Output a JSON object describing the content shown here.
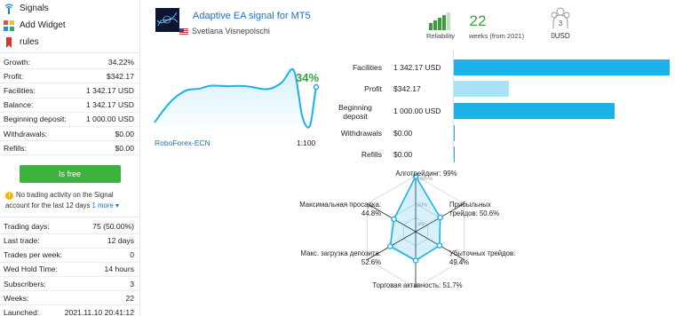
{
  "sidebar": {
    "menu": [
      {
        "label": "Signals",
        "icon": "signal-icon"
      },
      {
        "label": "Add Widget",
        "icon": "widget-icon"
      },
      {
        "label": "rules",
        "icon": "bookmark-icon"
      }
    ],
    "stats": [
      {
        "label": "Growth:",
        "value": "34.22%"
      },
      {
        "label": "Profit:",
        "value": "$342.17"
      },
      {
        "label": "Facilities:",
        "value": "1 342.17 USD"
      },
      {
        "label": "Balance:",
        "value": "1 342.17 USD"
      },
      {
        "label": "Beginning deposit:",
        "value": "1 000.00 USD"
      },
      {
        "label": "Withdrawals:",
        "value": "$0.00"
      },
      {
        "label": "Refills:",
        "value": "$0.00"
      }
    ],
    "free_button": "Is free",
    "notice": {
      "text": "No trading activity on the Signal account for the last 12 days",
      "more": "1 more"
    },
    "stats2": [
      {
        "label": "Trading days:",
        "value": "75 (50.00%)"
      },
      {
        "label": "Last trade:",
        "value": "12 days"
      },
      {
        "label": "Trades per week:",
        "value": "0"
      },
      {
        "label": "Wed Hold Time:",
        "value": "14 hours"
      },
      {
        "label": "Subscribers:",
        "value": "3"
      },
      {
        "label": "Weeks:",
        "value": "22"
      },
      {
        "label": "Launched:",
        "value": "2021.11.10 20:41:12"
      }
    ]
  },
  "header": {
    "title": "Adaptive EA signal for MT5",
    "author": "Svetlana Visnepolschi"
  },
  "metrics": {
    "reliability_label": "Reliability",
    "weeks_value": "22",
    "weeks_label": "weeks (from 2021)",
    "subscribers_count": "3",
    "subscription_price": "0USD"
  },
  "growth": {
    "value_label": "34%",
    "broker": "RoboForex-ECN",
    "leverage": "1:100"
  },
  "colors": {
    "accent_blue": "#1ab2e8",
    "light_blue": "#a7e2f7",
    "green": "#3db33d",
    "link": "#1a6fc9"
  },
  "chart_data": [
    {
      "type": "bar",
      "categories": [
        "Facilities",
        "Profit",
        "Beginning deposit",
        "Withdrawals",
        "Refills"
      ],
      "value_labels": [
        "1 342.17 USD",
        "$342.17",
        "1 000.00 USD",
        "$0.00",
        "$0.00"
      ],
      "values": [
        1342.17,
        342.17,
        1000.0,
        0,
        0
      ]
    },
    {
      "type": "radar",
      "axes": [
        {
          "label": "Алготрейдинг: 99%",
          "value": 99
        },
        {
          "label": "Прибыльных трейдов: 50.6%",
          "value": 50.6
        },
        {
          "label": "Убыточных трейдов: 49.4%",
          "value": 49.4
        },
        {
          "label": "Торговая активность: 51.7%",
          "value": 51.7
        },
        {
          "label": "Макс. загрузка депозита: 52.6%",
          "value": 52.6
        },
        {
          "label": "Максимальная просадка: 44.8%",
          "value": 44.8
        }
      ],
      "ring_labels": [
        "100+%",
        "50%",
        "0%"
      ]
    }
  ]
}
